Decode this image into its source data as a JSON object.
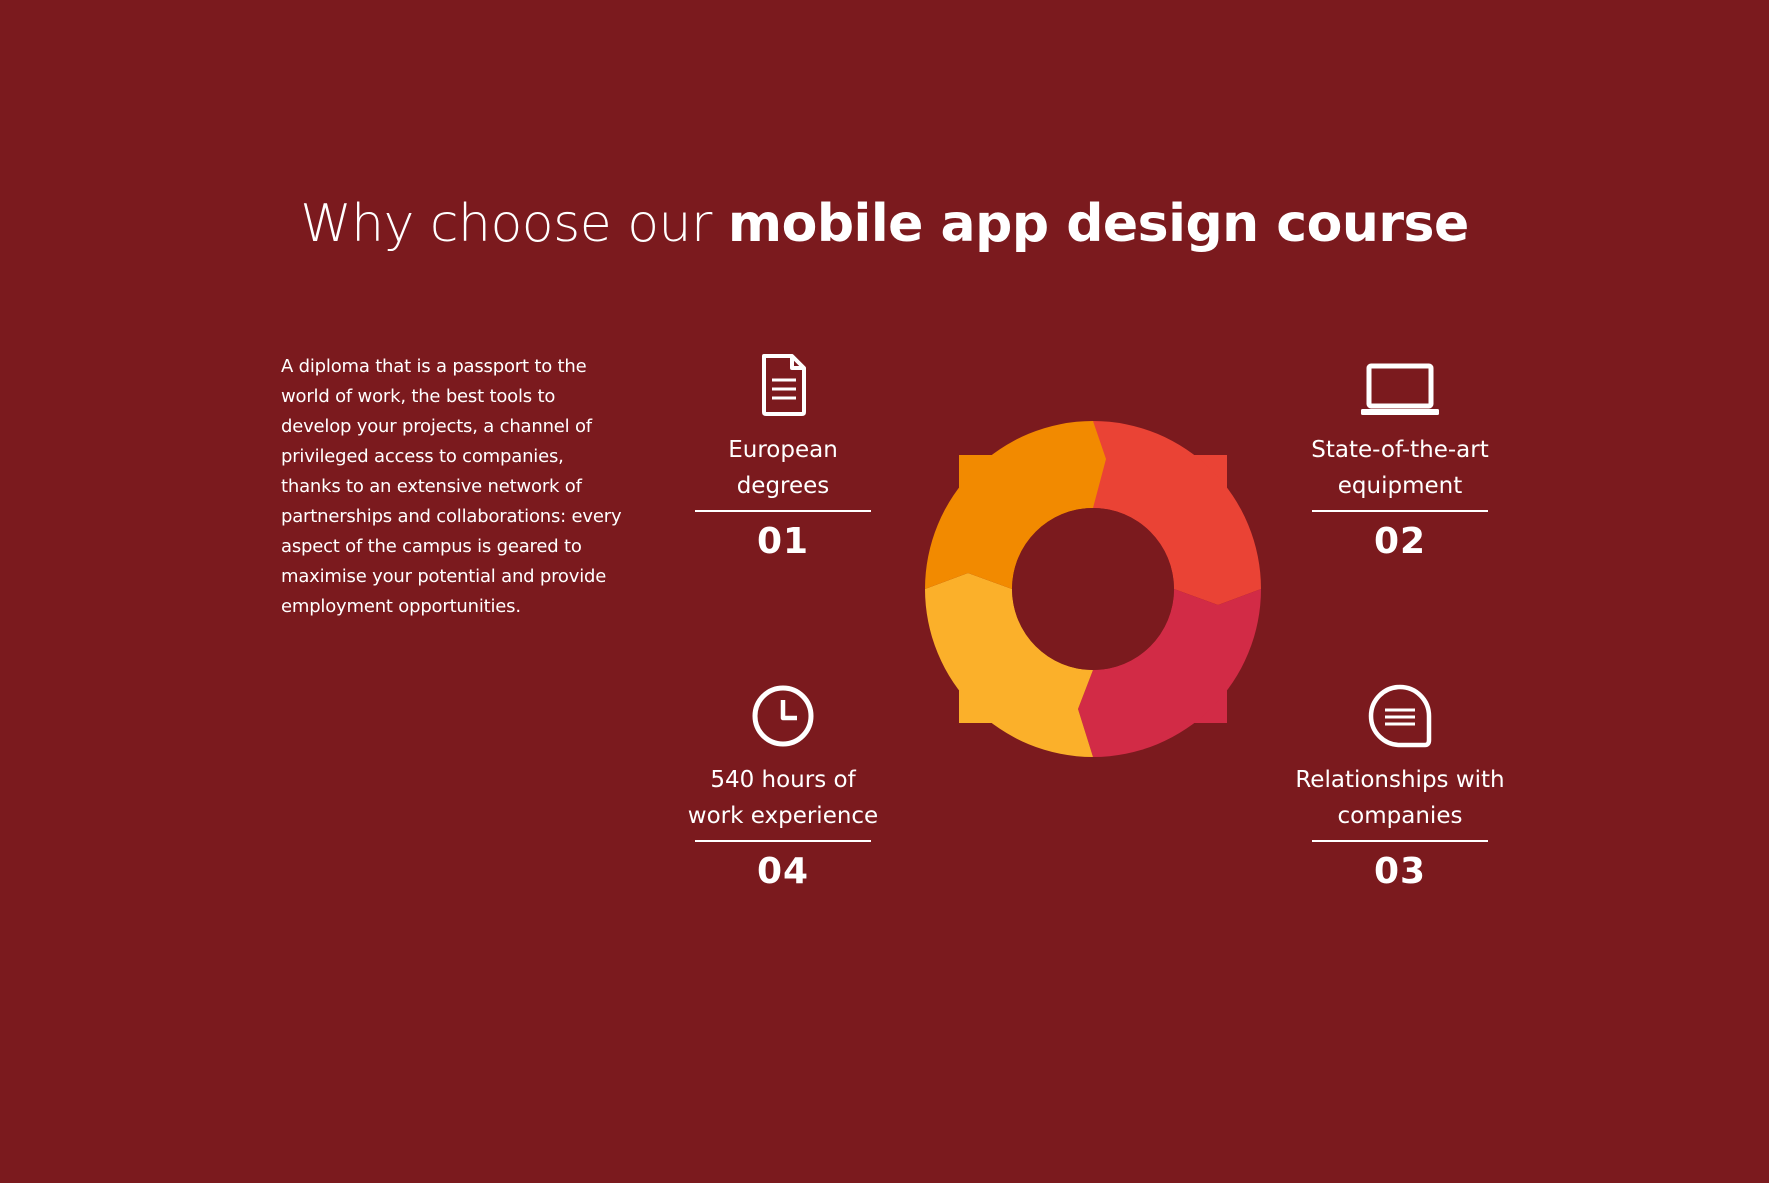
{
  "heading": {
    "light": "Why choose our ",
    "bold": "mobile app design course"
  },
  "intro_text": "A diploma that is a passport to the world of work, the best tools to develop your projects, a channel of privileged access to companies, thanks to an extensive network of partnerships and collaborations: every aspect of the campus is geared to maximise your potential and provide employment opportunities.",
  "features": [
    {
      "label": "European\ndegrees",
      "number": "01",
      "icon": "document-icon"
    },
    {
      "label": "State-of-the-art\nequipment",
      "number": "02",
      "icon": "laptop-icon"
    },
    {
      "label": "Relationships with\ncompanies",
      "number": "03",
      "icon": "chat-bubble-icon"
    },
    {
      "label": "540 hours of\nwork experience",
      "number": "04",
      "icon": "clock-icon"
    }
  ],
  "colors": {
    "background": "#7b1a1e",
    "segment_top_left": "#f28a00",
    "segment_top_right": "#ea4335",
    "segment_bottom_right": "#d22b46",
    "segment_bottom_left": "#fbb02a",
    "text": "#ffffff"
  }
}
